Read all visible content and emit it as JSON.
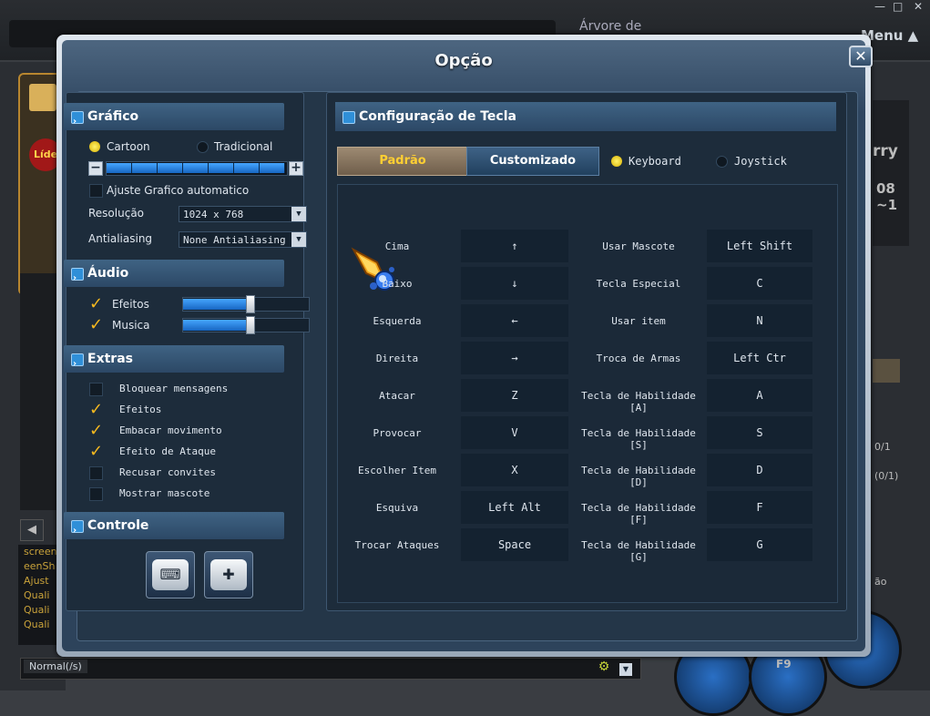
{
  "background": {
    "tree_label": "Árvore de",
    "menu_label": "Menu ▲",
    "window_controls": [
      "—",
      "□",
      "✕"
    ],
    "chat_lines": [
      "screen",
      "eenSh",
      "Ajust",
      "Quali",
      "Quali",
      "Quali"
    ],
    "chat_channel": "Normal(/s)",
    "right_texts": [
      "rry",
      "08",
      "~1",
      "0/1",
      "(0/1)",
      "ão",
      "F9"
    ],
    "left_badge": "Líde"
  },
  "dialog": {
    "title": "Opção",
    "close_label": "✕"
  },
  "grafico": {
    "header": "Gráfico",
    "mode_options": [
      "Cartoon",
      "Tradicional"
    ],
    "mode_selected": "Cartoon",
    "quality_level": 1.0,
    "quality_segments": 7,
    "auto_label": "Ajuste Grafico automatico",
    "auto_checked": false,
    "resolution_label": "Resolução",
    "resolution_value": "1024 x 768",
    "antialias_label": "Antialiasing",
    "antialias_value": "None Antialiasing"
  },
  "audio": {
    "header": "Áudio",
    "effects_label": "Efeitos",
    "effects_checked": true,
    "effects_level": 0.53,
    "music_label": "Musica",
    "music_checked": true,
    "music_level": 0.53
  },
  "extras": {
    "header": "Extras",
    "items": [
      {
        "label": "Bloquear mensagens",
        "checked": false
      },
      {
        "label": "Efeitos",
        "checked": true
      },
      {
        "label": "Embacar movimento",
        "checked": true
      },
      {
        "label": "Efeito de Ataque",
        "checked": true
      },
      {
        "label": "Recusar convites",
        "checked": false
      },
      {
        "label": "Mostrar mascote",
        "checked": false
      }
    ]
  },
  "controle": {
    "header": "Controle",
    "buttons": [
      "keyboard-icon",
      "gamepad-icon"
    ]
  },
  "keyconfig": {
    "header": "Configuração de Tecla",
    "tabs": [
      "Padrão",
      "Customizado"
    ],
    "active_tab": "Padrão",
    "device_options": [
      "Keyboard",
      "Joystick"
    ],
    "device_selected": "Keyboard",
    "left_rows": [
      {
        "action": "Cima",
        "key": "↑"
      },
      {
        "action": "Baixo",
        "key": "↓"
      },
      {
        "action": "Esquerda",
        "key": "←"
      },
      {
        "action": "Direita",
        "key": "→"
      },
      {
        "action": "Atacar",
        "key": "Z"
      },
      {
        "action": "Provocar",
        "key": "V"
      },
      {
        "action": "Escolher Item",
        "key": "X"
      },
      {
        "action": "Esquiva",
        "key": "Left Alt"
      },
      {
        "action": "Trocar Ataques",
        "key": "Space"
      }
    ],
    "right_rows": [
      {
        "action": "Usar Mascote",
        "key": "Left Shift"
      },
      {
        "action": "Tecla Especial",
        "key": "C"
      },
      {
        "action": "Usar item",
        "key": "N"
      },
      {
        "action": "Troca de Armas",
        "key": "Left Ctr"
      },
      {
        "action": "Tecla de Habilidade [A]",
        "key": "A"
      },
      {
        "action": "Tecla de Habilidade [S]",
        "key": "S"
      },
      {
        "action": "Tecla de Habilidade [D]",
        "key": "D"
      },
      {
        "action": "Tecla de Habilidade [F]",
        "key": "F"
      },
      {
        "action": "Tecla de Habilidade [G]",
        "key": "G"
      }
    ]
  },
  "colors": {
    "accent_blue": "#2f8fd8",
    "check_gold": "#f4b81f",
    "tab_active_text": "#ffcf33"
  }
}
